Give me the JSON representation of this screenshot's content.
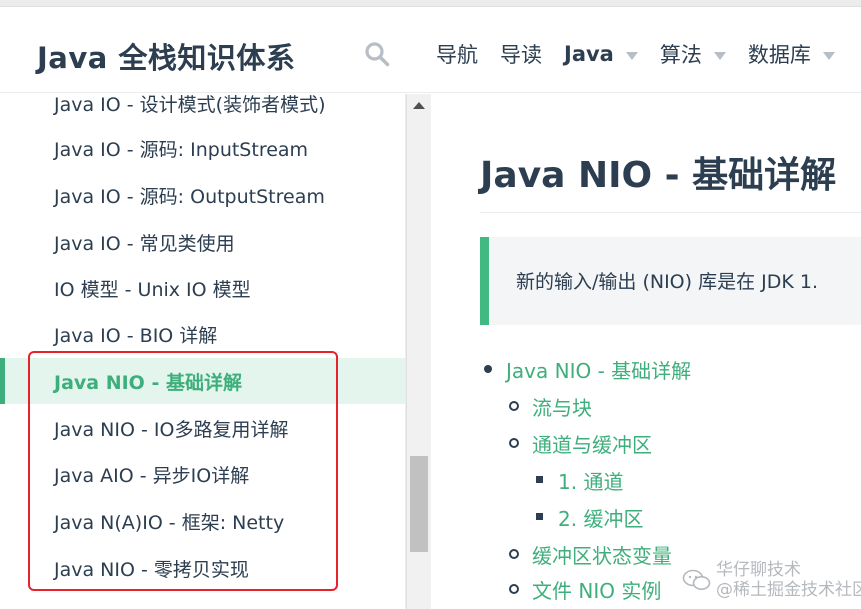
{
  "header": {
    "site_title": "Java 全栈知识体系",
    "nav": [
      {
        "label": "导航",
        "has_dropdown": false,
        "bold": false
      },
      {
        "label": "导读",
        "has_dropdown": false,
        "bold": false
      },
      {
        "label": "Java",
        "has_dropdown": true,
        "bold": true
      },
      {
        "label": "算法",
        "has_dropdown": true,
        "bold": false
      },
      {
        "label": "数据库",
        "has_dropdown": true,
        "bold": false
      }
    ],
    "icons": {
      "search": "search-icon",
      "dropdown": "chevron-down-icon"
    }
  },
  "sidebar": {
    "items": [
      {
        "label": "Java IO - 设计模式(装饰者模式)",
        "active": false
      },
      {
        "label": "Java IO - 源码: InputStream",
        "active": false
      },
      {
        "label": "Java IO - 源码: OutputStream",
        "active": false
      },
      {
        "label": "Java IO - 常见类使用",
        "active": false
      },
      {
        "label": "IO 模型 - Unix IO 模型",
        "active": false
      },
      {
        "label": "Java IO - BIO 详解",
        "active": false
      },
      {
        "label": "Java NIO - 基础详解",
        "active": true
      },
      {
        "label": "Java NIO - IO多路复用详解",
        "active": false
      },
      {
        "label": "Java AIO - 异步IO详解",
        "active": false
      },
      {
        "label": "Java N(A)IO - 框架: Netty",
        "active": false
      },
      {
        "label": "Java NIO - 零拷贝实现",
        "active": false
      }
    ]
  },
  "main": {
    "title": "Java NIO - 基础详解",
    "tip": "新的输入/输出 (NIO) 库是在 JDK 1.",
    "toc": [
      {
        "label": "Java NIO - 基础详解",
        "level": 1
      },
      {
        "label": "流与块",
        "level": 2
      },
      {
        "label": "通道与缓冲区",
        "level": 2
      },
      {
        "label": "1. 通道",
        "level": 3
      },
      {
        "label": "2. 缓冲区",
        "level": 3
      },
      {
        "label": "缓冲区状态变量",
        "level": 2
      },
      {
        "label": "文件 NIO 实例",
        "level": 2
      }
    ]
  },
  "watermark": {
    "line1": "华仔聊技术",
    "line2": "@稀土掘金技术社区"
  },
  "colors": {
    "accent": "#3eaf7c",
    "highlight_border": "#e8222d",
    "text": "#2c3e50",
    "active_bg": "#e3f5ec"
  }
}
